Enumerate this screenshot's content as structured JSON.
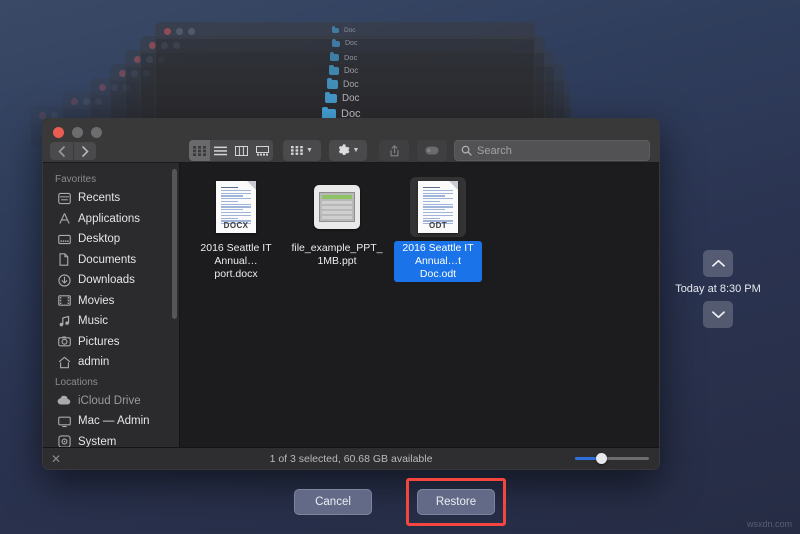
{
  "background": {
    "color_top": "#3a4a66",
    "color_bottom": "#262c44"
  },
  "watermark": "wsxdn.com",
  "stack": {
    "label_text": "Doc",
    "folder_icon": "folder-icon",
    "ghost_count": 7
  },
  "finder": {
    "traffic_lights": [
      "close-button",
      "minimize-button",
      "zoom-button"
    ],
    "nav": {
      "back_icon": "chevron-left-icon",
      "forward_icon": "chevron-right-icon"
    },
    "view_modes": [
      {
        "name": "icon-view",
        "icon": "grid-icon",
        "active": true
      },
      {
        "name": "list-view",
        "icon": "list-icon",
        "active": false
      },
      {
        "name": "column-view",
        "icon": "columns-icon",
        "active": false
      },
      {
        "name": "gallery-view",
        "icon": "gallery-icon",
        "active": false
      }
    ],
    "group_button": {
      "name": "group-by-button",
      "icon": "grid-small-icon",
      "chevron": "chevron-down-icon"
    },
    "action_button": {
      "name": "action-menu-button",
      "icon": "gear-icon",
      "chevron": "chevron-down-icon"
    },
    "share_button": {
      "name": "share-button",
      "icon": "share-icon"
    },
    "tag_button": {
      "name": "tag-button",
      "icon": "tag-icon"
    },
    "search": {
      "placeholder": "Search",
      "value": "",
      "icon": "search-icon"
    },
    "sidebar": {
      "sections": [
        {
          "header": "Favorites",
          "items": [
            {
              "label": "Recents",
              "icon": "recents-icon"
            },
            {
              "label": "Applications",
              "icon": "applications-icon"
            },
            {
              "label": "Desktop",
              "icon": "desktop-icon"
            },
            {
              "label": "Documents",
              "icon": "documents-icon"
            },
            {
              "label": "Downloads",
              "icon": "downloads-icon"
            },
            {
              "label": "Movies",
              "icon": "movies-icon"
            },
            {
              "label": "Music",
              "icon": "music-icon"
            },
            {
              "label": "Pictures",
              "icon": "pictures-icon"
            },
            {
              "label": "admin",
              "icon": "home-icon"
            }
          ]
        },
        {
          "header": "Locations",
          "items": [
            {
              "label": "iCloud Drive",
              "icon": "cloud-icon",
              "dim": true
            },
            {
              "label": "Mac — Admin",
              "icon": "display-icon",
              "dim": false
            },
            {
              "label": "System",
              "icon": "disk-icon",
              "dim": false
            }
          ]
        }
      ]
    },
    "files": [
      {
        "name": "2016 Seattle IT Annual…port.docx",
        "line1": "2016 Seattle IT",
        "line2": "Annual…port.docx",
        "kind": "docx",
        "badge": "DOCX",
        "selected": false
      },
      {
        "name": "file_example_PPT_1MB.ppt",
        "line1": "file_example_PPT_",
        "line2": "1MB.ppt",
        "kind": "ppt",
        "badge": "",
        "selected": false
      },
      {
        "name": "2016 Seattle IT Annual…t Doc.odt",
        "line1": "2016 Seattle IT",
        "line2": "Annual…t Doc.odt",
        "kind": "odt",
        "badge": "ODT",
        "selected": true
      }
    ],
    "status": {
      "text": "1 of 3 selected, 60.68 GB available",
      "close_icon": "x-icon",
      "zoom_slider_value": 28
    }
  },
  "timemachine": {
    "up_icon": "chevron-up-icon",
    "down_icon": "chevron-down-icon",
    "date_label": "Today at 8:30 PM"
  },
  "actions": {
    "cancel_label": "Cancel",
    "restore_label": "Restore",
    "highlight_color": "#f4463f"
  }
}
